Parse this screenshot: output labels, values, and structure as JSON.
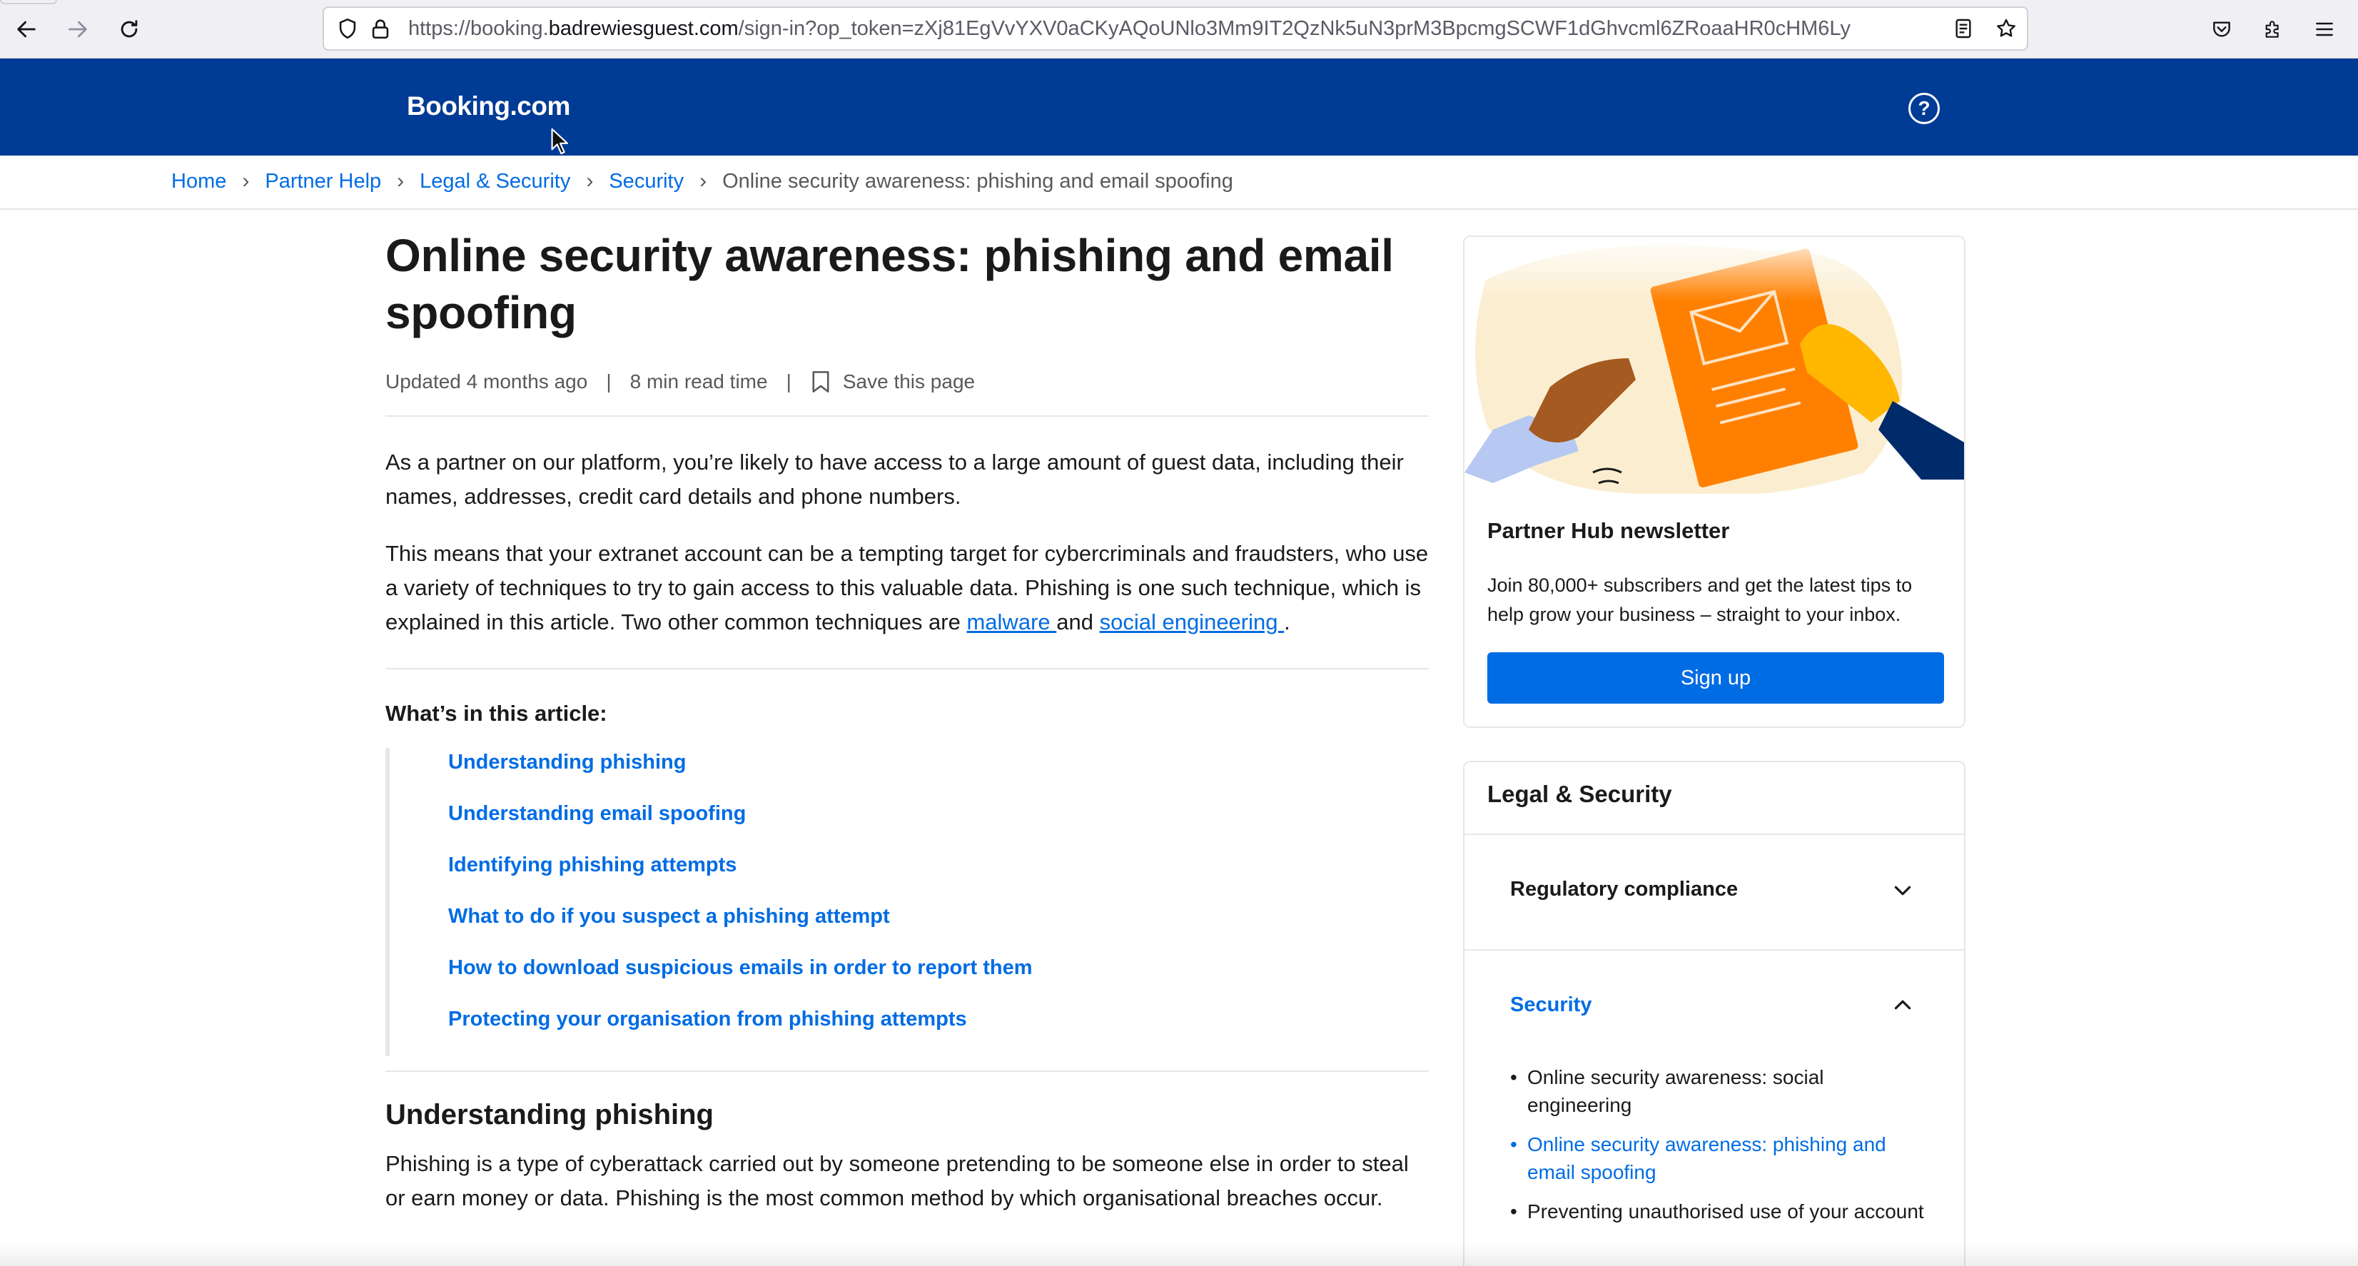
{
  "browser": {
    "url_prefix": "https://booking.",
    "url_domain": "badrewiesguest.com",
    "url_path": "/sign-in?op_token=zXj81EgVvYXV0aCKyAQoUNlo3Mm9IT2QzNk5uN3prM3BpcmgSCWF1dGhvcml6ZRoaaHR0cHM6Ly"
  },
  "header": {
    "logo": "Booking.com",
    "help_glyph": "?"
  },
  "breadcrumb": {
    "items": [
      "Home",
      "Partner Help",
      "Legal & Security",
      "Security"
    ],
    "current": "Online security awareness: phishing and email spoofing",
    "separator": "›"
  },
  "article": {
    "title": "Online security awareness: phishing and email spoofing",
    "updated": "Updated 4 months ago",
    "read_time": "8 min read time",
    "meta_separator": "|",
    "save_label": "Save this page",
    "para1": "As a partner on our platform, you’re likely to have access to a large amount of guest data, including their names, addresses, credit card details and phone numbers.",
    "para2_a": "This means that your extranet account can be a tempting target for cybercriminals and fraudsters, who use a variety of techniques to try to gain access to this valuable data. Phishing is one such technique, which is explained in this article. Two other common techniques are ",
    "link_malware": "malware ",
    "para2_and": "and ",
    "link_social": "social engineering ",
    "para2_end": ".",
    "toc_title": "What’s in this article:",
    "toc": [
      "Understanding phishing",
      "Understanding email spoofing",
      "Identifying phishing attempts",
      "What to do if you suspect a phishing attempt",
      "How to download suspicious emails in order to report them",
      "Protecting your organisation from phishing attempts"
    ],
    "section1_title": "Understanding phishing",
    "section1_para": "Phishing is a type of cyberattack carried out by someone pretending to be someone else in order to steal or earn money or data. Phishing is the most common method by which organisational breaches occur."
  },
  "newsletter": {
    "title": "Partner Hub newsletter",
    "text": "Join 80,000+ subscribers and get the latest tips to help grow your business – straight to your inbox.",
    "button": "Sign up"
  },
  "sidebar": {
    "title": "Legal & Security",
    "sections": [
      {
        "label": "Regulatory compliance",
        "expanded": false
      },
      {
        "label": "Security",
        "expanded": true
      }
    ],
    "security_items": [
      {
        "label": "Online security awareness: social engineering",
        "active": false
      },
      {
        "label": "Online security awareness: phishing and email spoofing",
        "active": true
      },
      {
        "label": "Preventing unauthorised use of your account",
        "active": false
      }
    ]
  },
  "colors": {
    "brand_header": "#003b95",
    "link": "#006ce4",
    "text": "#1a1a1a",
    "muted": "#595959"
  }
}
